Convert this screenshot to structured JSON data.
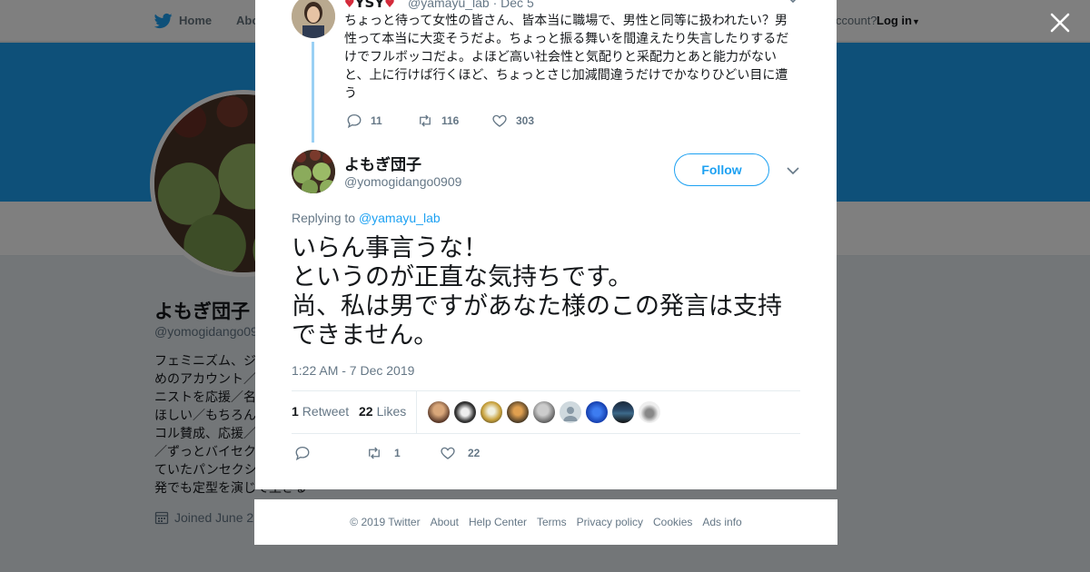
{
  "topnav": {
    "home": "Home",
    "about": "Abo",
    "account_prompt": "ccount?",
    "login": "Log in"
  },
  "profile": {
    "name": "よもぎ団子",
    "handle": "@yomogidango09",
    "bio_lines": [
      "フェミニズム、ジ",
      "めのアカウント／",
      "ニストを応援／名",
      "ほしい／もちろん",
      "コル賛成、応援／",
      "／ずっとバイセク",
      "ていたパンセクシ"
    ],
    "bio_end": "発でも定型を演じて生きる",
    "joined": "Joined June 2"
  },
  "parent_tweet": {
    "name": "YSY",
    "handle": "@yamayu_lab",
    "date": "Dec 5",
    "text": "ちょっと待って女性の皆さん、皆本当に職場で、男性と同等に扱われたい？男性って本当に大変そうだよ。ちょっと振る舞いを間違えたり失言したりするだけでフルボッコだよ。よほど高い社会性と気配りと采配力とあと能力がないと、上に行けば行くほど、ちょっとさじ加減間違うだけでかなりひどい目に遭う",
    "replies": "11",
    "retweets": "116",
    "likes": "303"
  },
  "main_tweet": {
    "name": "よもぎ団子",
    "handle": "@yomogidango0909",
    "follow_label": "Follow",
    "replying_prefix": "Replying to",
    "replying_to": "@yamayu_lab",
    "text_lines": [
      "いらん事言うな！",
      "というのが正直な気持ちです。",
      "尚、私は男ですがあなた様のこの発言は支持",
      "できません。"
    ],
    "timestamp": "1:22 AM - 7 Dec 2019",
    "retweet_count": "1",
    "retweet_label": "Retweet",
    "like_count": "22",
    "like_label": "Likes",
    "actions": {
      "retweets": "1",
      "likes": "22"
    }
  },
  "likers": [
    "liker-1",
    "liker-2",
    "liker-3",
    "liker-4",
    "liker-5",
    "liker-6",
    "liker-7",
    "liker-8",
    "liker-9"
  ],
  "footer": [
    "© 2019 Twitter",
    "About",
    "Help Center",
    "Terms",
    "Privacy policy",
    "Cookies",
    "Ads info"
  ],
  "colors": {
    "accent": "#1da1f2",
    "thread_line": "#9ad0f4",
    "text_primary": "#14171a",
    "text_secondary": "#657786",
    "overlay": "rgba(0,0,0,0.5)"
  }
}
